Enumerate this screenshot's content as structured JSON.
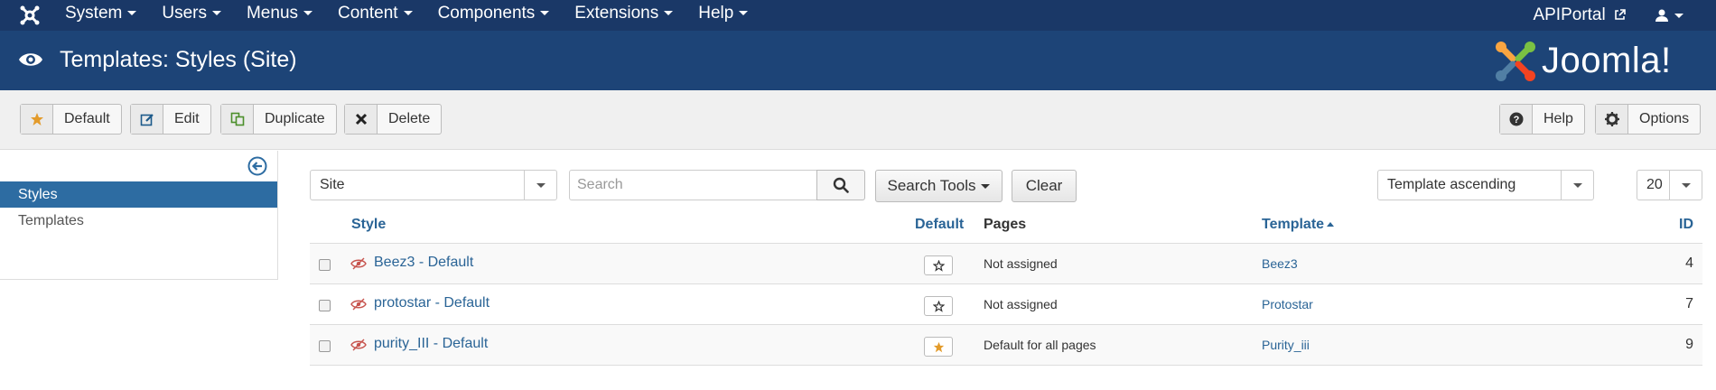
{
  "navbar": {
    "menu": [
      {
        "label": "System"
      },
      {
        "label": "Users"
      },
      {
        "label": "Menus"
      },
      {
        "label": "Content"
      },
      {
        "label": "Components"
      },
      {
        "label": "Extensions"
      },
      {
        "label": "Help"
      }
    ],
    "site_name": "APIPortal"
  },
  "header": {
    "title": "Templates: Styles (Site)",
    "brand": "Joomla!"
  },
  "toolbar": {
    "default_label": "Default",
    "edit_label": "Edit",
    "duplicate_label": "Duplicate",
    "delete_label": "Delete",
    "help_label": "Help",
    "options_label": "Options"
  },
  "sidebar": {
    "items": [
      {
        "label": "Styles",
        "active": true
      },
      {
        "label": "Templates",
        "active": false
      }
    ]
  },
  "filters": {
    "client": "Site",
    "search_placeholder": "Search",
    "search_tools_label": "Search Tools",
    "clear_label": "Clear",
    "ordering": "Template ascending",
    "limit": "20"
  },
  "table": {
    "headers": {
      "style": "Style",
      "default": "Default",
      "pages": "Pages",
      "template": "Template",
      "id": "ID"
    },
    "rows": [
      {
        "style": "Beez3 - Default",
        "is_default": false,
        "pages": "Not assigned",
        "template": "Beez3",
        "id": "4"
      },
      {
        "style": "protostar - Default",
        "is_default": false,
        "pages": "Not assigned",
        "template": "Protostar",
        "id": "7"
      },
      {
        "style": "purity_III - Default",
        "is_default": true,
        "pages": "Default for all pages",
        "template": "Purity_iii",
        "id": "9"
      }
    ]
  },
  "colors": {
    "navbar": "#1a3867",
    "header": "#1d4477",
    "sidebar_active": "#2d6ca2",
    "link": "#2a6496",
    "star_default": "#e39b2b"
  }
}
